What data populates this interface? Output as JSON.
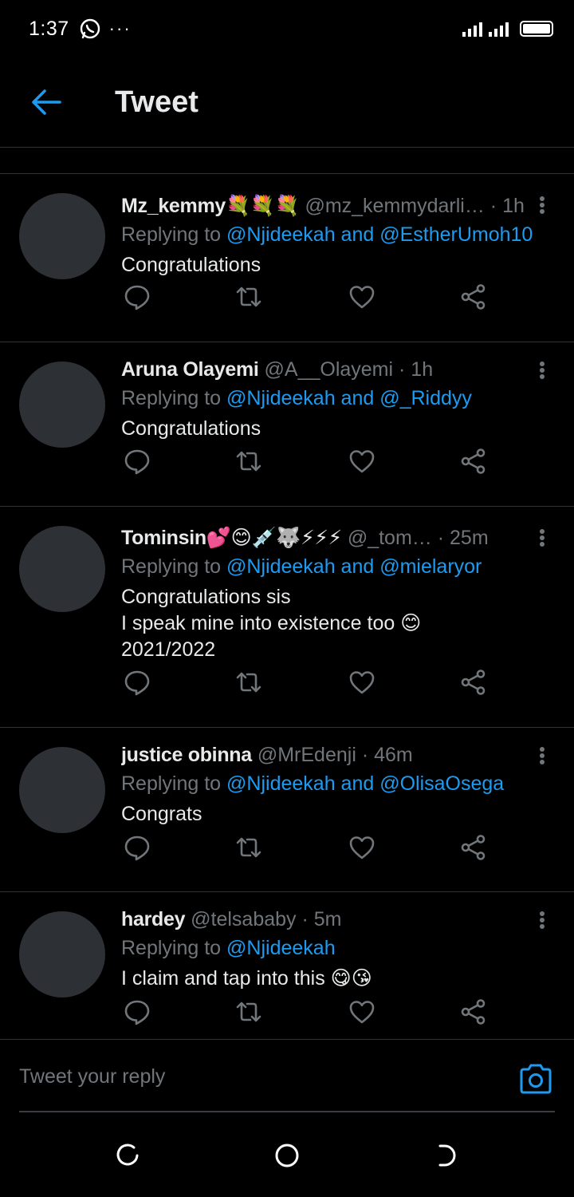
{
  "status_bar": {
    "time": "1:37",
    "dots": "···"
  },
  "header": {
    "title": "Tweet"
  },
  "replying_to_prefix": "Replying to",
  "tweets": [
    {
      "name": "Mz_kemmy💐💐💐",
      "handle": "@mz_kemmydarli…",
      "time": "· 1h",
      "mentions": "@Njideekah and @EstherUmoh10",
      "text": "Congratulations"
    },
    {
      "name": "Aruna Olayemi",
      "handle": "@A__Olayemi",
      "time": "· 1h",
      "mentions": "@Njideekah and @_Riddyy",
      "text": "Congratulations"
    },
    {
      "name": "Tominsin💕😊💉🐺⚡⚡⚡",
      "handle": "@_tom…",
      "time": "· 25m",
      "mentions": "@Njideekah and @mielaryor",
      "text": "Congratulations sis\nI speak mine into existence too 😊\n2021/2022"
    },
    {
      "name": "justice obinna",
      "handle": "@MrEdenji",
      "time": "· 46m",
      "mentions": "@Njideekah and @OlisaOsega",
      "text": "Congrats"
    },
    {
      "name": "hardey",
      "handle": "@telsababy",
      "time": "· 5m",
      "mentions": "@Njideekah",
      "text": "I claim and tap into this 😋😘"
    }
  ],
  "reply_bar": {
    "placeholder": "Tweet your reply"
  },
  "icons": {
    "back": "arrow-left-icon",
    "reply": "reply-icon",
    "retweet": "retweet-icon",
    "like": "heart-icon",
    "share": "share-icon",
    "more": "more-vertical-icon",
    "camera": "camera-icon"
  },
  "colors": {
    "background": "#000000",
    "accent": "#1d9bf0",
    "secondary_text": "#71767b",
    "primary_text": "#e7e9ea",
    "avatar": "#2d3035"
  }
}
